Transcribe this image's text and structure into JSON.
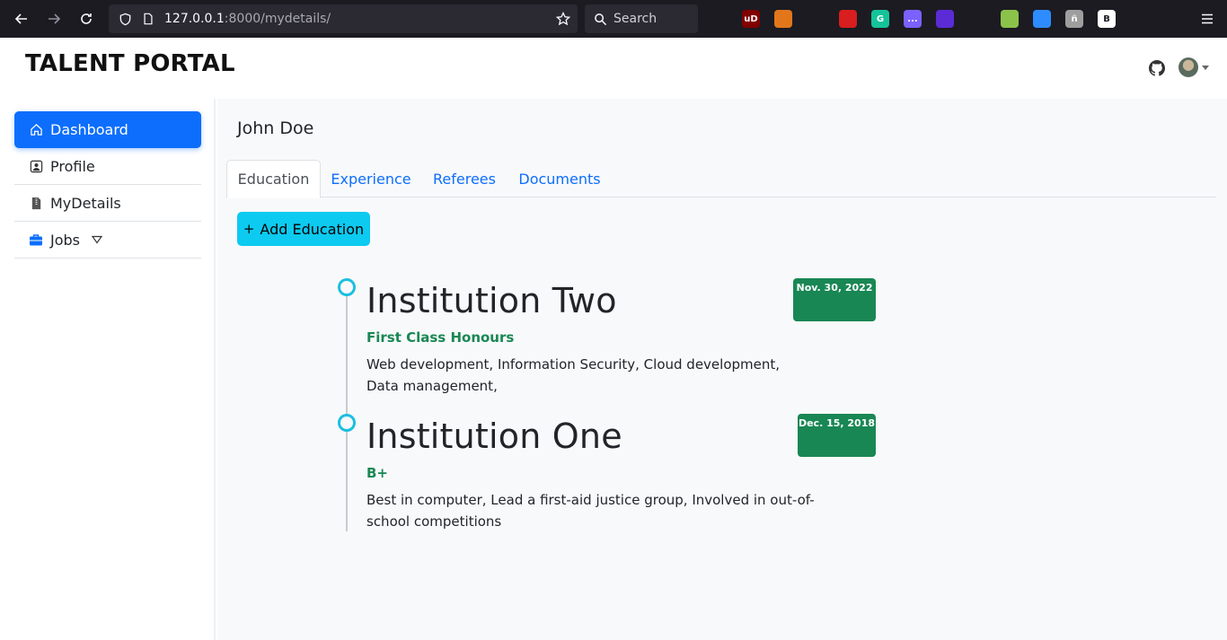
{
  "browser": {
    "url_host": "127.0.0.1",
    "url_path": ":8000/mydetails/",
    "search_placeholder": "Search",
    "extensions": [
      {
        "name": "pocket-icon",
        "color": "#1c1b22",
        "label": ""
      },
      {
        "name": "ublock-icon",
        "color": "#800000",
        "label": "uD"
      },
      {
        "name": "metamask-icon",
        "color": "#e2761b",
        "label": ""
      },
      {
        "name": "react-devtools-icon",
        "color": "#1c1b22",
        "label": ""
      },
      {
        "name": "highlighter-icon",
        "color": "#d81e1e",
        "label": ""
      },
      {
        "name": "grammarly-icon",
        "color": "#15c39a",
        "label": "G"
      },
      {
        "name": "chat-extension-icon",
        "color": "#7b61ff",
        "label": "..."
      },
      {
        "name": "stack-extension-icon",
        "color": "#5b2bd6",
        "label": ""
      },
      {
        "name": "bird-extension-icon",
        "color": "#1c1b22",
        "label": ""
      },
      {
        "name": "colorzilla-icon",
        "color": "#8bc34a",
        "label": ""
      },
      {
        "name": "zoom-icon",
        "color": "#2d8cff",
        "label": ""
      },
      {
        "name": "translate-icon",
        "color": "#9e9e9e",
        "label": "ñ"
      },
      {
        "name": "bootstrap-icon",
        "color": "#ffffff",
        "label": "B"
      },
      {
        "name": "triangle-icon",
        "color": "#1c1b22",
        "label": ""
      },
      {
        "name": "graphql-icon",
        "color": "#1c1b22",
        "label": ""
      }
    ]
  },
  "header": {
    "brand": "TALENT PORTAL"
  },
  "sidebar": {
    "items": [
      {
        "label": "Dashboard",
        "icon": "home-icon"
      },
      {
        "label": "Profile",
        "icon": "person-icon"
      },
      {
        "label": "MyDetails",
        "icon": "file-icon"
      },
      {
        "label": "Jobs",
        "icon": "briefcase-icon"
      }
    ]
  },
  "main": {
    "person_name": "John Doe",
    "tabs": [
      {
        "label": "Education"
      },
      {
        "label": "Experience"
      },
      {
        "label": "Referees"
      },
      {
        "label": "Documents"
      }
    ],
    "add_button": "Add Education",
    "timeline": [
      {
        "institution": "Institution Two",
        "grade": "First Class Honours",
        "description": "Web development, Information Security, Cloud development, Data management,",
        "date": "Nov. 30, 2022"
      },
      {
        "institution": "Institution One",
        "grade": "B+",
        "description": "Best in computer, Lead a first-aid justice group, Involved in out-of-school competitions",
        "date": "Dec. 15, 2018"
      }
    ]
  },
  "colors": {
    "primary": "#0d6efd",
    "info": "#0dcaf0",
    "success": "#198754"
  }
}
